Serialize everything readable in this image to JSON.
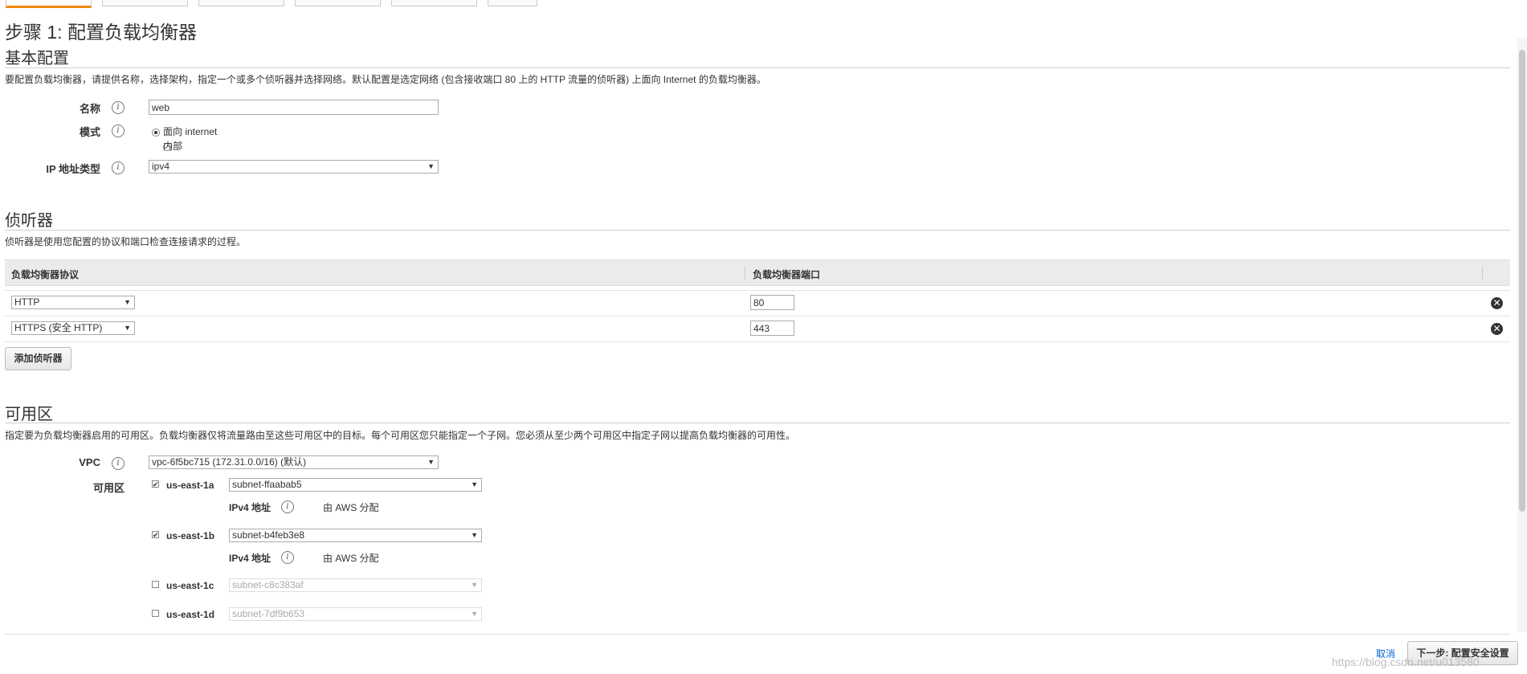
{
  "page": {
    "title": "步骤 1: 配置负载均衡器"
  },
  "basic": {
    "heading": "基本配置",
    "description": "要配置负载均衡器，请提供名称，选择架构，指定一个或多个侦听器并选择网络。默认配置是选定网络 (包含接收端口 80 上的 HTTP 流量的侦听器) 上面向 Internet 的负载均衡器。",
    "name_label": "名称",
    "name_value": "web",
    "mode_label": "模式",
    "mode_options": [
      "面向 internet",
      "内部"
    ],
    "ip_label": "IP 地址类型",
    "ip_value": "ipv4"
  },
  "listeners": {
    "heading": "侦听器",
    "description": "侦听器是使用您配置的协议和端口检查连接请求的过程。",
    "col_protocol": "负载均衡器协议",
    "col_port": "负载均衡器端口",
    "rows": [
      {
        "protocol": "HTTP",
        "port": "80"
      },
      {
        "protocol": "HTTPS (安全 HTTP)",
        "port": "443"
      }
    ],
    "add_button": "添加侦听器"
  },
  "az": {
    "heading": "可用区",
    "description": "指定要为负载均衡器启用的可用区。负载均衡器仅将流量路由至这些可用区中的目标。每个可用区您只能指定一个子网。您必须从至少两个可用区中指定子网以提高负载均衡器的可用性。",
    "vpc_label": "VPC",
    "vpc_value": "vpc-6f5bc715 (172.31.0.0/16) (默认)",
    "zones_label": "可用区",
    "zones": [
      {
        "name": "us-east-1a",
        "subnet": "subnet-ffaabab5",
        "checked": true
      },
      {
        "name": "us-east-1b",
        "subnet": "subnet-b4feb3e8",
        "checked": true
      },
      {
        "name": "us-east-1c",
        "subnet": "subnet-c8c383af",
        "checked": false
      },
      {
        "name": "us-east-1d",
        "subnet": "subnet-7df9b653",
        "checked": false
      }
    ],
    "ipv4_label": "IPv4 地址",
    "ipv4_value": "由 AWS 分配"
  },
  "footer": {
    "cancel": "取消",
    "next": "下一步: 配置安全设置",
    "watermark": "https://blog.csdn.net/u013580"
  },
  "icons": {
    "info": "info-icon",
    "remove": "remove-icon",
    "dropdown": "chevron-down-icon",
    "accent": "#f08800",
    "link": "#0066cc"
  }
}
